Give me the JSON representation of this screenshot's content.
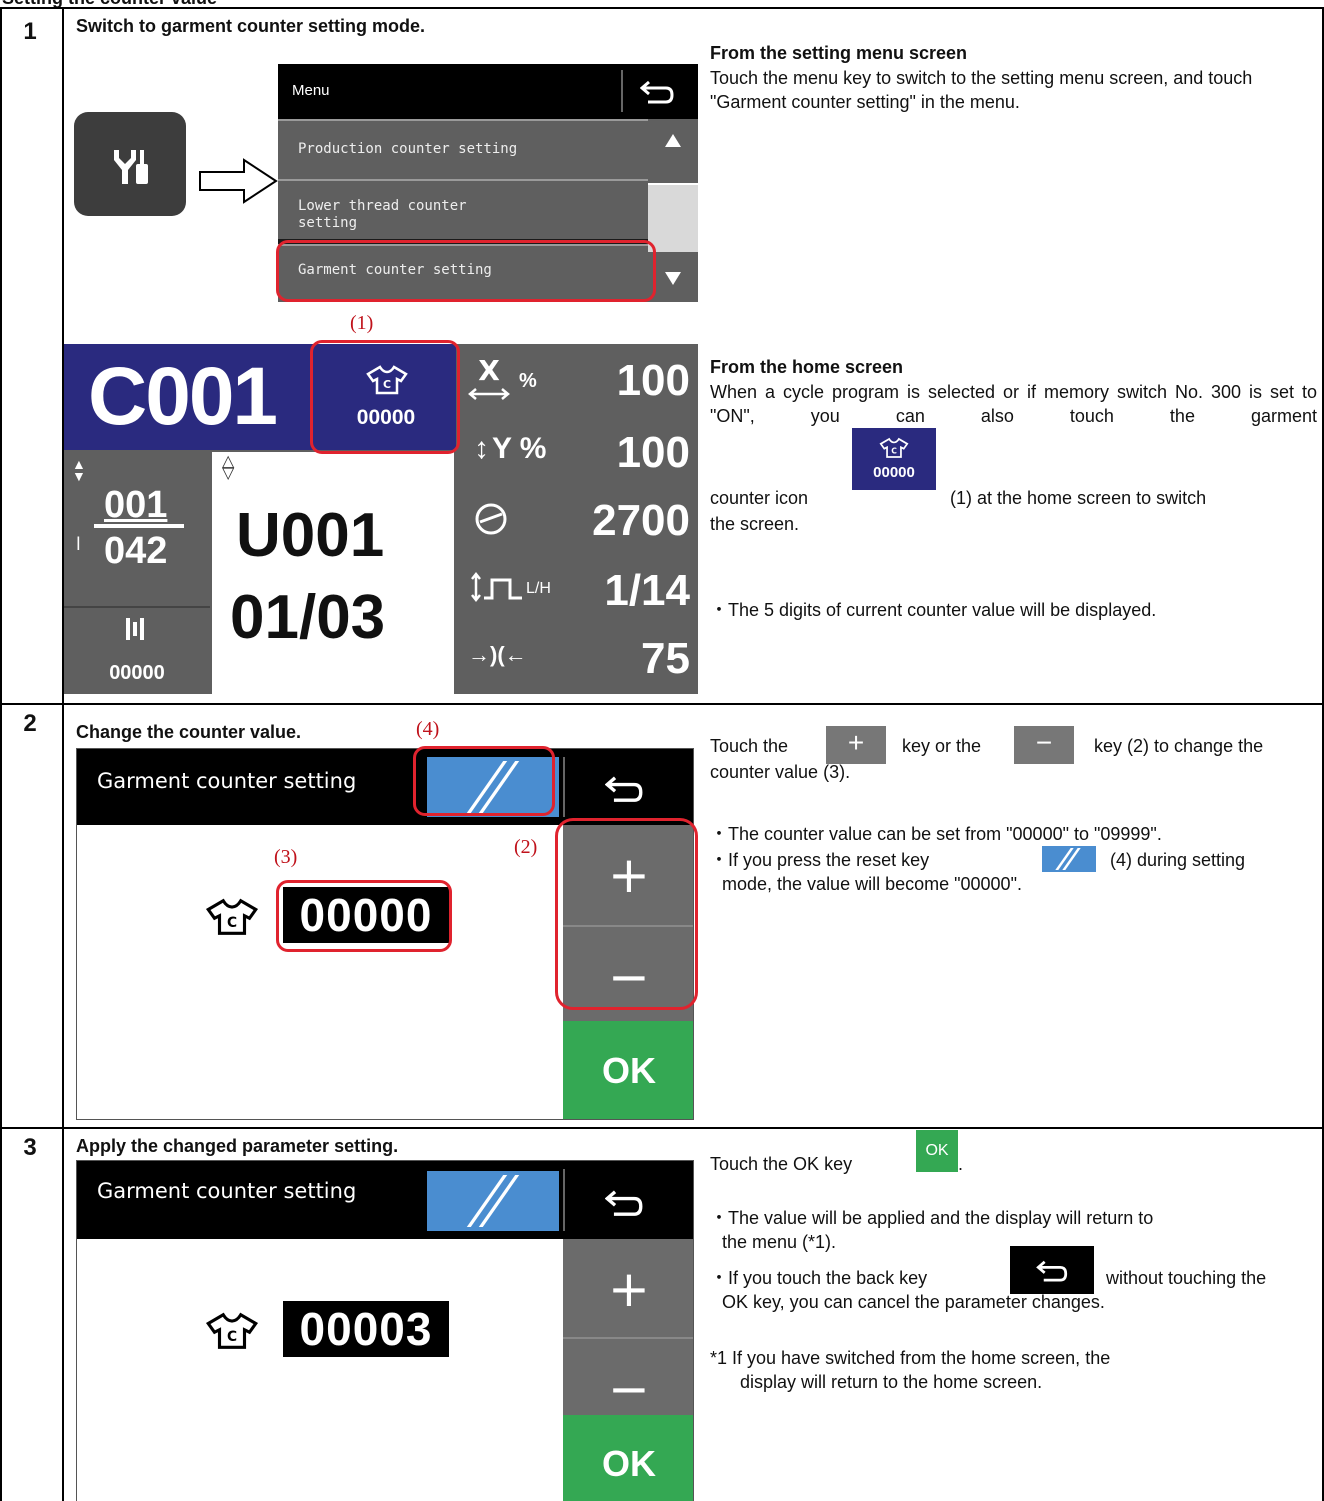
{
  "page": {
    "partial_title": "Setting the counter value"
  },
  "steps": [
    {
      "num": "1",
      "title": "Switch to garment counter setting mode."
    },
    {
      "num": "2",
      "title": "Change the counter value."
    },
    {
      "num": "3",
      "title": "Apply the changed parameter setting."
    }
  ],
  "step1": {
    "menu_heading": "From the setting menu screen",
    "menu_text": "Touch the menu key to switch to the setting menu screen, and touch \"Garment counter setting\" in the menu.",
    "home_heading": "From the home screen",
    "home_text_1": "When a cycle program is selected or if memory switch No. 300 is set to \"ON\", you can also touch the garment",
    "home_text_2a": "counter icon",
    "home_text_2b": "(1) at the home screen to switch",
    "home_text_3": "the screen.",
    "bullet": "・The 5 digits of current counter value will be displayed.",
    "ann1": "(1)"
  },
  "menu_screen": {
    "title": "Menu",
    "items": [
      "Production counter setting",
      "Lower thread counter\nsetting",
      "Garment counter setting"
    ]
  },
  "home_screen": {
    "program": "C001",
    "garment_count": "00000",
    "x_label": "%",
    "x_value": "100",
    "y_label": "Y %",
    "y_value": "100",
    "speed": "2700",
    "lh_label": "L/H",
    "lh_value": "1/14",
    "gap_value": "75",
    "step_cur": "001",
    "step_total": "042",
    "pattern": "U001",
    "page": "01/03",
    "thread_count": "00000"
  },
  "step2": {
    "ann4": "(4)",
    "ann2": "(2)",
    "ann3": "(3)",
    "t1a": "Touch the",
    "t1b": "key or the",
    "t1c": "key (2) to change the",
    "t2": "counter value (3).",
    "b1": "・The counter value can be set from \"00000\" to \"09999\".",
    "b2a": "・If you press the reset key",
    "b2b": "(4) during setting",
    "b2c": "mode, the value will become \"00000\".",
    "screen_title": "Garment counter setting",
    "value": "00000",
    "ok": "OK"
  },
  "step3": {
    "t1": "Touch the OK key",
    "ok_small": "OK",
    "b1a": "・The value will be applied and the display will return to",
    "b1b": "the menu (*1).",
    "b2a": "・If you touch the back key",
    "b2b": "without touching the",
    "b2c": "OK key, you can cancel the parameter changes.",
    "n1a": "*1 If you have switched from the home screen, the",
    "n1b": "display will return to the home screen.",
    "screen_title": "Garment counter setting",
    "value": "00003",
    "ok": "OK"
  },
  "keys": {
    "plus": "+",
    "minus": "−",
    "back": "⮌"
  }
}
